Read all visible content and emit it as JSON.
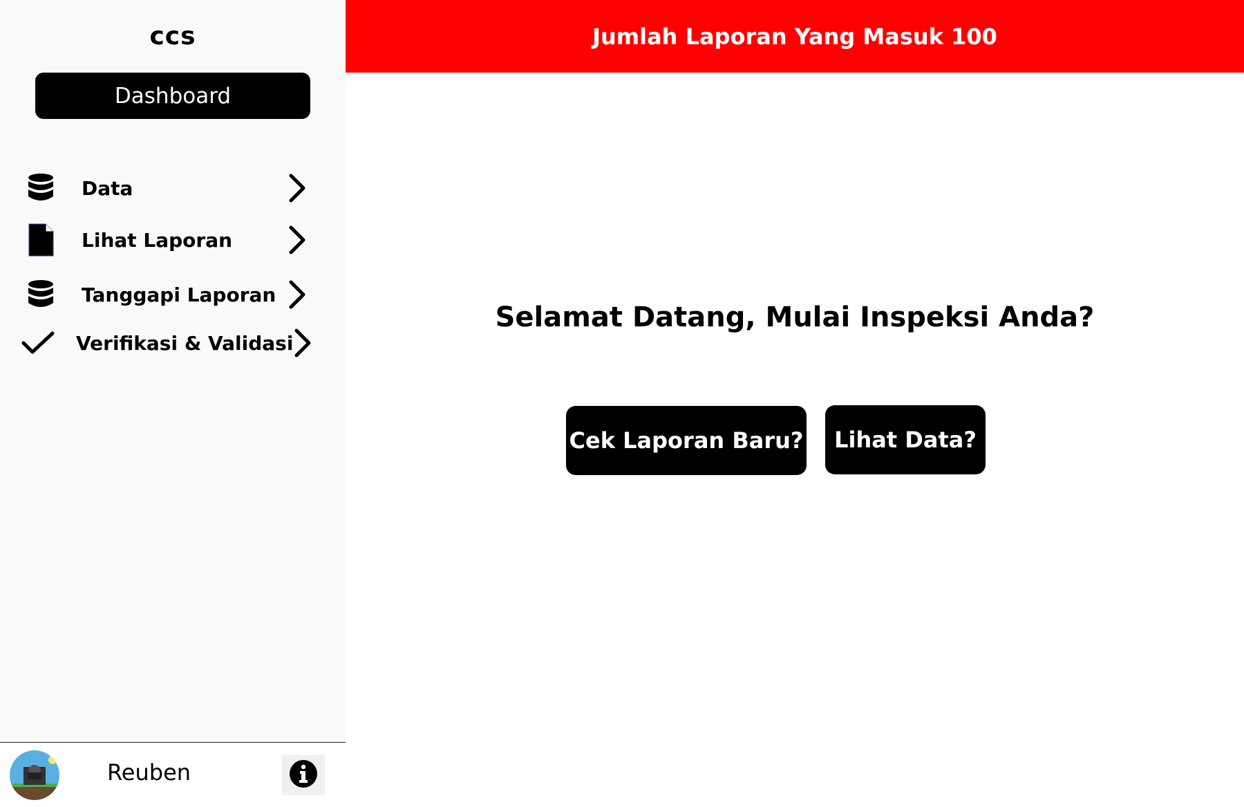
{
  "sidebar": {
    "app_title": "ccs",
    "dashboard_label": "Dashboard",
    "items": [
      {
        "label": "Data",
        "icon": "database-icon"
      },
      {
        "label": "Lihat Laporan",
        "icon": "file-icon"
      },
      {
        "label": "Tanggapi Laporan",
        "icon": "database-icon"
      },
      {
        "label": "Verifikasi & Validasi",
        "icon": "checkmark-icon"
      }
    ],
    "footer": {
      "username": "Reuben",
      "info_icon": "info-icon"
    }
  },
  "header": {
    "banner_text": "Jumlah Laporan Yang Masuk 100",
    "color": "#ff0000"
  },
  "main": {
    "welcome_text": "Selamat Datang, Mulai Inspeksi Anda?",
    "buttons": {
      "cek_laporan": "Cek Laporan Baru?",
      "lihat_data": "Lihat Data?"
    }
  }
}
